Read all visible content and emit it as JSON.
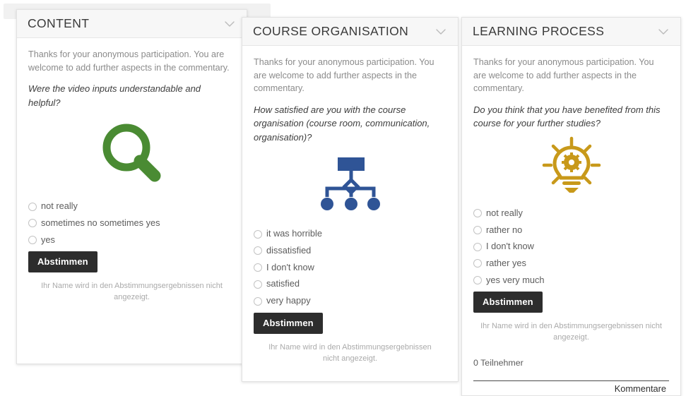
{
  "common": {
    "intro": "Thanks for your anonymous participation. You are welcome to add further aspects in the commentary.",
    "vote_button": "Abstimmen",
    "privacy_note": "Ihr Name wird in den Abstimmungsergebnissen nicht angezeigt.",
    "chevron_icon": "chevron-down-icon"
  },
  "colors": {
    "magnifier_green": "#4a8b33",
    "orgchart_blue": "#2f5496",
    "bulb_gold": "#c8991a",
    "button_dark": "#2d2d2d",
    "header_bg": "#f7f7f7"
  },
  "cards": [
    {
      "id": "content",
      "title": "CONTENT",
      "question": "Were the video inputs understandable and helpful?",
      "icon": "magnifying-glass-icon",
      "options": [
        "not really",
        "sometimes no sometimes yes",
        "yes"
      ]
    },
    {
      "id": "organisation",
      "title": "COURSE ORGANISATION",
      "question": "How satisfied are you with the course organisation (course room, communication, organisation)?",
      "icon": "organisation-chart-icon",
      "options": [
        "it was horrible",
        "dissatisfied",
        "I don't know",
        "satisfied",
        "very happy"
      ]
    },
    {
      "id": "learning",
      "title": "LEARNING PROCESS",
      "question": "Do you think that you have benefited from this course for your further studies?",
      "icon": "lightbulb-gear-icon",
      "options": [
        "not really",
        "rather no",
        "I don't know",
        "rather yes",
        "yes very much"
      ],
      "participants": "0 Teilnehmer",
      "comments_label": "Kommentare"
    }
  ]
}
